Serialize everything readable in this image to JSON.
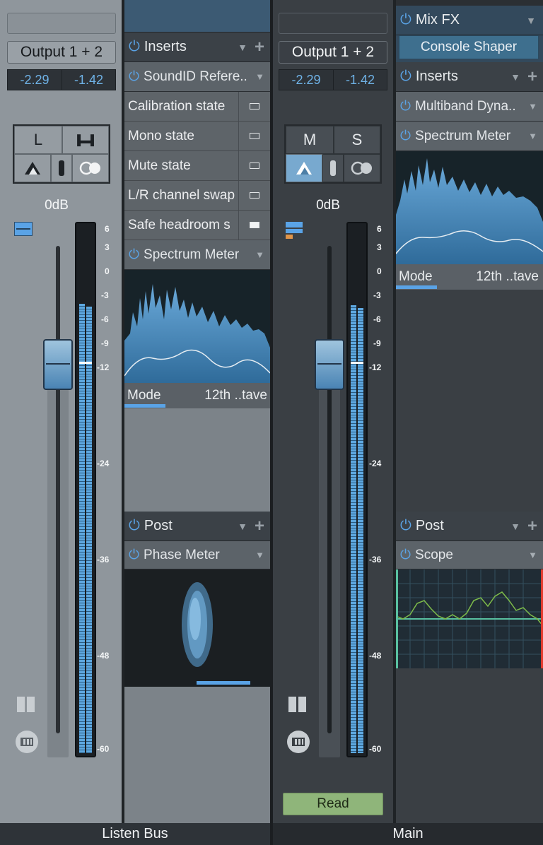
{
  "channels": [
    {
      "id": "listen-bus",
      "name": "Listen Bus",
      "output": "Output 1 + 2",
      "meter_left": "-2.29",
      "meter_right": "-1.42",
      "buttons": [
        "L"
      ],
      "fader_value": "0dB",
      "scale": [
        "6",
        "3",
        "0",
        "-3",
        "-6",
        "-9",
        "-12",
        "-24",
        "-36",
        "-48",
        "-60"
      ],
      "inserts_label": "Inserts",
      "insert_plugins": [
        {
          "name": "SoundID Refere..",
          "params": [
            {
              "label": "Calibration state",
              "checked": false
            },
            {
              "label": "Mono state",
              "checked": false
            },
            {
              "label": "Mute state",
              "checked": false
            },
            {
              "label": "L/R channel swap",
              "checked": false
            },
            {
              "label": "Safe headroom s",
              "checked": true
            }
          ]
        },
        {
          "name": "Spectrum Meter"
        }
      ],
      "spectrum_mode_label": "Mode",
      "spectrum_mode_value": "12th ..tave",
      "post_label": "Post",
      "post_plugin": "Phase Meter"
    },
    {
      "id": "main",
      "name": "Main",
      "output": "Output 1 + 2",
      "meter_left": "-2.29",
      "meter_right": "-1.42",
      "buttons": [
        "M",
        "S"
      ],
      "fader_value": "0dB",
      "scale": [
        "6",
        "3",
        "0",
        "-3",
        "-6",
        "-9",
        "-12",
        "-24",
        "-36",
        "-48",
        "-60"
      ],
      "mixfx_label": "Mix FX",
      "mixfx_plugin": "Console Shaper",
      "inserts_label": "Inserts",
      "insert_plugins": [
        {
          "name": "Multiband Dyna.."
        },
        {
          "name": "Spectrum Meter"
        }
      ],
      "spectrum_mode_label": "Mode",
      "spectrum_mode_value": "12th ..tave",
      "post_label": "Post",
      "post_plugin": "Scope",
      "automation": "Read"
    }
  ],
  "icons": {
    "power": "power-icon",
    "dropdown": "dropdown-triangle-icon",
    "add": "plus-icon"
  },
  "colors": {
    "accent_blue": "#5aa3e6",
    "meter_blue": "#6fb2e6",
    "scope_green": "#7dbb4a",
    "read_green": "#8fb57a"
  }
}
